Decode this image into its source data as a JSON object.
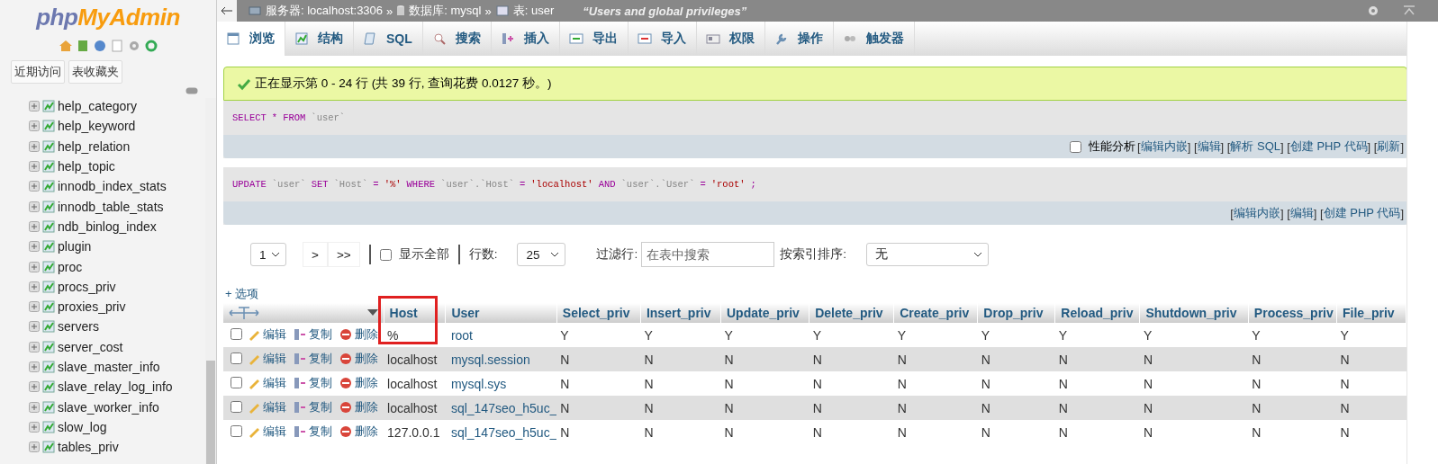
{
  "sidebar": {
    "logo": {
      "first": "php",
      "second": "MyAdmin"
    },
    "tabs": [
      {
        "label": "近期访问"
      },
      {
        "label": "表收藏夹"
      }
    ],
    "tree": [
      {
        "label": "help_category"
      },
      {
        "label": "help_keyword"
      },
      {
        "label": "help_relation"
      },
      {
        "label": "help_topic"
      },
      {
        "label": "innodb_index_stats"
      },
      {
        "label": "innodb_table_stats"
      },
      {
        "label": "ndb_binlog_index"
      },
      {
        "label": "plugin"
      },
      {
        "label": "proc"
      },
      {
        "label": "procs_priv"
      },
      {
        "label": "proxies_priv"
      },
      {
        "label": "servers"
      },
      {
        "label": "server_cost"
      },
      {
        "label": "slave_master_info"
      },
      {
        "label": "slave_relay_log_info"
      },
      {
        "label": "slave_worker_info"
      },
      {
        "label": "slow_log"
      },
      {
        "label": "tables_priv"
      }
    ]
  },
  "breadcrumb": {
    "items": [
      {
        "kind": "server",
        "label": "服务器: localhost:3306"
      },
      {
        "kind": "database",
        "label": "数据库: mysql"
      },
      {
        "kind": "table",
        "label": "表: user"
      }
    ],
    "separator": "»",
    "comment": "“Users and global privileges”"
  },
  "tabs": [
    {
      "kind": "browse",
      "label": "浏览",
      "selected": true
    },
    {
      "kind": "structure",
      "label": "结构",
      "selected": false
    },
    {
      "kind": "sql",
      "label": "SQL",
      "selected": false
    },
    {
      "kind": "search",
      "label": "搜索",
      "selected": false
    },
    {
      "kind": "insert",
      "label": "插入",
      "selected": false
    },
    {
      "kind": "export",
      "label": "导出",
      "selected": false
    },
    {
      "kind": "import",
      "label": "导入",
      "selected": false
    },
    {
      "kind": "privileges",
      "label": "权限",
      "selected": false
    },
    {
      "kind": "operations",
      "label": "操作",
      "selected": false
    },
    {
      "kind": "triggers",
      "label": "触发器",
      "selected": false
    }
  ],
  "message": "正在显示第 0 - 24 行 (共 39 行, 查询花费 0.0127 秒。)",
  "queries": [
    {
      "tokens": [
        {
          "kind": "keyword",
          "text": "SELECT"
        },
        {
          "kind": "op",
          "text": "*"
        },
        {
          "kind": "keyword",
          "text": "FROM"
        },
        {
          "kind": "ident",
          "text": "`user`"
        }
      ],
      "profiling": {
        "label": "性能分析",
        "checked": false
      },
      "links": [
        {
          "kind": "text",
          "text": "["
        },
        {
          "kind": "link",
          "text": "编辑内嵌"
        },
        {
          "kind": "text",
          "text": "] ["
        },
        {
          "kind": "link",
          "text": "编辑"
        },
        {
          "kind": "text",
          "text": "] ["
        },
        {
          "kind": "link",
          "text": "解析 SQL"
        },
        {
          "kind": "text",
          "text": "] ["
        },
        {
          "kind": "link",
          "text": "创建 PHP 代码"
        },
        {
          "kind": "text",
          "text": "] ["
        },
        {
          "kind": "link",
          "text": "刷新"
        },
        {
          "kind": "text",
          "text": "]"
        }
      ]
    },
    {
      "tokens": [
        {
          "kind": "keyword",
          "text": "UPDATE"
        },
        {
          "kind": "ident",
          "text": "`user`"
        },
        {
          "kind": "keyword",
          "text": "SET"
        },
        {
          "kind": "ident",
          "text": "`Host`"
        },
        {
          "kind": "op",
          "text": "="
        },
        {
          "kind": "string",
          "text": "'%'"
        },
        {
          "kind": "keyword",
          "text": "WHERE"
        },
        {
          "kind": "ident",
          "text": "`user`.`Host`"
        },
        {
          "kind": "op",
          "text": "="
        },
        {
          "kind": "string",
          "text": "'localhost'"
        },
        {
          "kind": "keyword",
          "text": "AND"
        },
        {
          "kind": "ident",
          "text": "`user`.`User`"
        },
        {
          "kind": "op",
          "text": "="
        },
        {
          "kind": "string",
          "text": "'root'"
        },
        {
          "kind": "op",
          "text": ";"
        }
      ],
      "links": [
        {
          "kind": "text",
          "text": "["
        },
        {
          "kind": "link",
          "text": "编辑内嵌"
        },
        {
          "kind": "text",
          "text": "] ["
        },
        {
          "kind": "link",
          "text": "编辑"
        },
        {
          "kind": "text",
          "text": "] ["
        },
        {
          "kind": "link",
          "text": "创建 PHP 代码"
        },
        {
          "kind": "text",
          "text": "]"
        }
      ]
    }
  ],
  "nav": {
    "page": "1",
    "buttons": [
      ">",
      ">>"
    ],
    "show_all": {
      "label": "显示全部",
      "checked": false
    },
    "rows_label": "行数:",
    "rows": "25",
    "filter_label": "过滤行:",
    "filter_placeholder": "在表中搜索",
    "sort_label": "按索引排序:",
    "sort": "无"
  },
  "options_link": "+ 选项",
  "table": {
    "columns": [
      {
        "label": "Host",
        "framed": true
      },
      {
        "label": "User",
        "framed": false
      },
      {
        "label": "Select_priv",
        "framed": false
      },
      {
        "label": "Insert_priv",
        "framed": false
      },
      {
        "label": "Update_priv",
        "framed": false
      },
      {
        "label": "Delete_priv",
        "framed": false
      },
      {
        "label": "Create_priv",
        "framed": false
      },
      {
        "label": "Drop_priv",
        "framed": false
      },
      {
        "label": "Reload_priv",
        "framed": false
      },
      {
        "label": "Shutdown_priv",
        "framed": false
      },
      {
        "label": "Process_priv",
        "framed": false
      },
      {
        "label": "File_priv",
        "framed": false
      }
    ],
    "rows": [
      {
        "checked": false,
        "actions": [
          "编辑",
          "复制",
          "删除"
        ],
        "cells": [
          "%",
          "root",
          "Y",
          "Y",
          "Y",
          "Y",
          "Y",
          "Y",
          "Y",
          "Y",
          "Y",
          "Y"
        ]
      },
      {
        "checked": false,
        "actions": [
          "编辑",
          "复制",
          "删除"
        ],
        "cells": [
          "localhost",
          "mysql.session",
          "N",
          "N",
          "N",
          "N",
          "N",
          "N",
          "N",
          "N",
          "N",
          "N"
        ]
      },
      {
        "checked": false,
        "actions": [
          "编辑",
          "复制",
          "删除"
        ],
        "cells": [
          "localhost",
          "mysql.sys",
          "N",
          "N",
          "N",
          "N",
          "N",
          "N",
          "N",
          "N",
          "N",
          "N"
        ]
      },
      {
        "checked": false,
        "actions": [
          "编辑",
          "复制",
          "删除"
        ],
        "cells": [
          "localhost",
          "sql_147seo_h5uc_",
          "N",
          "N",
          "N",
          "N",
          "N",
          "N",
          "N",
          "N",
          "N",
          "N"
        ]
      },
      {
        "checked": false,
        "actions": [
          "编辑",
          "复制",
          "删除"
        ],
        "cells": [
          "127.0.0.1",
          "sql_147seo_h5uc_",
          "N",
          "N",
          "N",
          "N",
          "N",
          "N",
          "N",
          "N",
          "N",
          "N"
        ]
      }
    ]
  }
}
